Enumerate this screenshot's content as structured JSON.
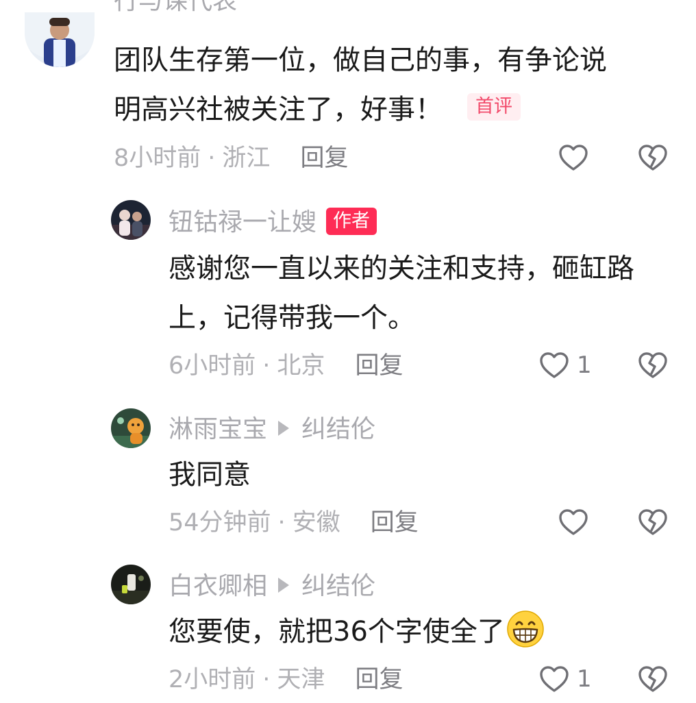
{
  "comments": [
    {
      "name": "行与课代表",
      "lines": [
        "团队生存第一位，做自己的事，有争论说",
        "明高兴社被关注了，好事！"
      ],
      "first_badge": "首评",
      "time": "8小时前",
      "location": "浙江",
      "reply": "回复",
      "likes": ""
    },
    {
      "name": "钮钴禄一让嫂",
      "author_badge": "作者",
      "lines": [
        "感谢您一直以来的关注和支持，砸缸路",
        "上，记得带我一个。"
      ],
      "time": "6小时前",
      "location": "北京",
      "reply": "回复",
      "likes": "1"
    },
    {
      "name": "淋雨宝宝",
      "reply_to": "纠结伦",
      "lines": [
        "我同意"
      ],
      "time": "54分钟前",
      "location": "安徽",
      "reply": "回复",
      "likes": ""
    },
    {
      "name": "白衣卿相",
      "reply_to": "纠结伦",
      "lines": [
        "您要使，就把36个字使全了"
      ],
      "emoji": "grinning-emoji",
      "time": "2小时前",
      "location": "天津",
      "reply": "回复",
      "likes": "1"
    }
  ],
  "meta_separator": "·",
  "icons": {
    "like": "heart-outline-icon",
    "dislike": "broken-heart-icon",
    "reply_arrow": "triangle-right-icon"
  },
  "colors": {
    "author_badge": "#fe2c55",
    "first_badge_bg": "#ffeef1",
    "first_badge_text": "#f24a6a",
    "meta_text": "#b0b0b4"
  }
}
